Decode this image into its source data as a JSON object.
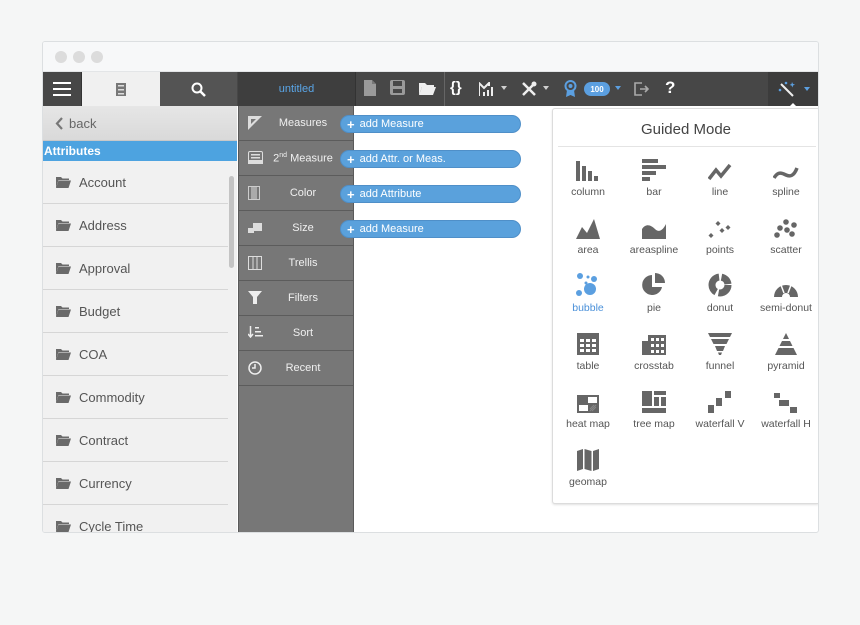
{
  "window": {
    "title": "untitled",
    "traffic_lights": [
      "close",
      "minimize",
      "maximize"
    ]
  },
  "toolbar": {
    "left_icons": [
      "menu-icon",
      "list-icon",
      "search-icon"
    ],
    "document_title": "untitled",
    "tools": [
      {
        "name": "new-file-icon"
      },
      {
        "name": "save-icon"
      },
      {
        "name": "open-folder-icon"
      },
      {
        "name": "code-braces-icon",
        "label": "{}"
      },
      {
        "name": "chart-type-icon",
        "has_dropdown": true
      },
      {
        "name": "tools-icon",
        "has_dropdown": true
      },
      {
        "name": "award-icon"
      },
      {
        "name": "score-badge",
        "value": "100",
        "has_dropdown": true
      },
      {
        "name": "export-icon"
      },
      {
        "name": "help-icon",
        "label": "?"
      },
      {
        "name": "magic-wand-icon",
        "has_dropdown": true
      }
    ],
    "accent_color": "#5b9fe0"
  },
  "left_panel": {
    "back_label": "back",
    "section_header": "Attributes",
    "items": [
      {
        "label": "Account"
      },
      {
        "label": "Address"
      },
      {
        "label": "Approval"
      },
      {
        "label": "Budget"
      },
      {
        "label": "COA"
      },
      {
        "label": "Commodity"
      },
      {
        "label": "Contract"
      },
      {
        "label": "Currency"
      },
      {
        "label": "Cycle Time"
      }
    ]
  },
  "middle_panel": {
    "items": [
      {
        "label": "Measures",
        "icon": "measures-icon"
      },
      {
        "label_prefix": "2",
        "label_sup": "nd",
        "label_suffix": " Measure",
        "icon": "second-measure-icon"
      },
      {
        "label": "Color",
        "icon": "color-icon"
      },
      {
        "label": "Size",
        "icon": "size-icon"
      },
      {
        "label": "Trellis",
        "icon": "trellis-icon"
      },
      {
        "label": "Filters",
        "icon": "filter-icon"
      },
      {
        "label": "Sort",
        "icon": "sort-icon"
      },
      {
        "label": "Recent",
        "icon": "clock-icon"
      }
    ]
  },
  "drop_targets": [
    {
      "label": "add Measure"
    },
    {
      "label": "add Attr. or Meas."
    },
    {
      "label": "add Attribute"
    },
    {
      "label": "add Measure"
    }
  ],
  "guided_mode": {
    "title": "Guided Mode",
    "selected": "bubble",
    "chart_types": [
      {
        "label": "column"
      },
      {
        "label": "bar"
      },
      {
        "label": "line"
      },
      {
        "label": "spline"
      },
      {
        "label": "area"
      },
      {
        "label": "areaspline"
      },
      {
        "label": "points"
      },
      {
        "label": "scatter"
      },
      {
        "label": "bubble"
      },
      {
        "label": "pie"
      },
      {
        "label": "donut"
      },
      {
        "label": "semi-donut"
      },
      {
        "label": "table"
      },
      {
        "label": "crosstab"
      },
      {
        "label": "funnel"
      },
      {
        "label": "pyramid"
      },
      {
        "label": "heat map"
      },
      {
        "label": "tree map"
      },
      {
        "label": "waterfall V"
      },
      {
        "label": "waterfall H"
      },
      {
        "label": "geomap"
      }
    ]
  }
}
